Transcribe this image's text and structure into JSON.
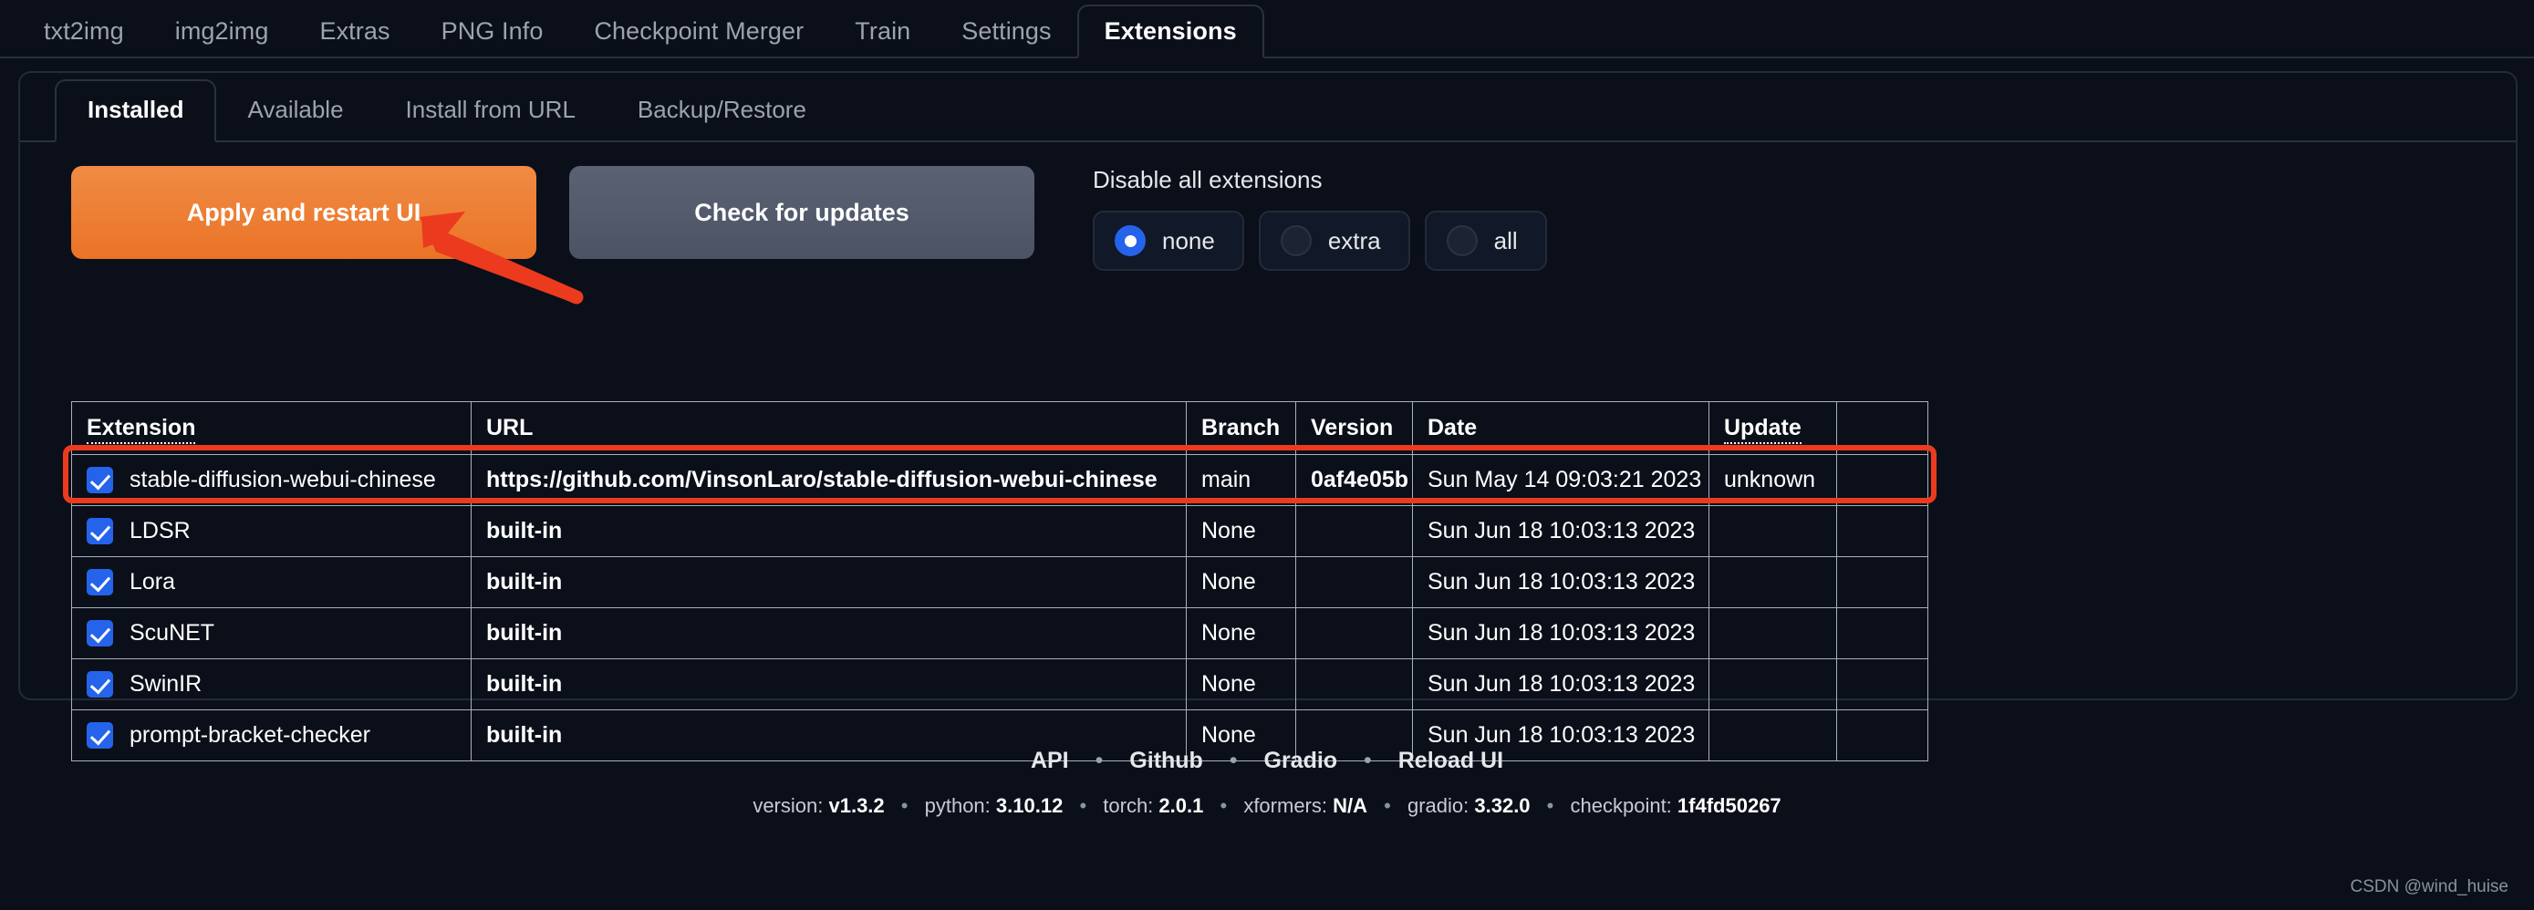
{
  "top_tabs": [
    {
      "label": "txt2img",
      "active": false
    },
    {
      "label": "img2img",
      "active": false
    },
    {
      "label": "Extras",
      "active": false
    },
    {
      "label": "PNG Info",
      "active": false
    },
    {
      "label": "Checkpoint Merger",
      "active": false
    },
    {
      "label": "Train",
      "active": false
    },
    {
      "label": "Settings",
      "active": false
    },
    {
      "label": "Extensions",
      "active": true
    }
  ],
  "sub_tabs": [
    {
      "label": "Installed",
      "active": true
    },
    {
      "label": "Available",
      "active": false
    },
    {
      "label": "Install from URL",
      "active": false
    },
    {
      "label": "Backup/Restore",
      "active": false
    }
  ],
  "controls": {
    "apply_label": "Apply and restart UI",
    "check_label": "Check for updates",
    "disable_label": "Disable all extensions",
    "radios": [
      {
        "label": "none",
        "selected": true
      },
      {
        "label": "extra",
        "selected": false
      },
      {
        "label": "all",
        "selected": false
      }
    ]
  },
  "table": {
    "headers": [
      "Extension",
      "URL",
      "Branch",
      "Version",
      "Date",
      "Update",
      ""
    ],
    "rows": [
      {
        "checked": true,
        "extension": "stable-diffusion-webui-chinese",
        "url": "https://github.com/VinsonLaro/stable-diffusion-webui-chinese",
        "branch": "main",
        "version": "0af4e05b",
        "date": "Sun May 14 09:03:21 2023",
        "update": "unknown",
        "action": "",
        "highlighted": true
      },
      {
        "checked": true,
        "extension": "LDSR",
        "url": "built-in",
        "branch": "None",
        "version": "",
        "date": "Sun Jun 18 10:03:13 2023",
        "update": "",
        "action": "",
        "highlighted": false
      },
      {
        "checked": true,
        "extension": "Lora",
        "url": "built-in",
        "branch": "None",
        "version": "",
        "date": "Sun Jun 18 10:03:13 2023",
        "update": "",
        "action": "",
        "highlighted": false
      },
      {
        "checked": true,
        "extension": "ScuNET",
        "url": "built-in",
        "branch": "None",
        "version": "",
        "date": "Sun Jun 18 10:03:13 2023",
        "update": "",
        "action": "",
        "highlighted": false
      },
      {
        "checked": true,
        "extension": "SwinIR",
        "url": "built-in",
        "branch": "None",
        "version": "",
        "date": "Sun Jun 18 10:03:13 2023",
        "update": "",
        "action": "",
        "highlighted": false
      },
      {
        "checked": true,
        "extension": "prompt-bracket-checker",
        "url": "built-in",
        "branch": "None",
        "version": "",
        "date": "Sun Jun 18 10:03:13 2023",
        "update": "",
        "action": "",
        "highlighted": false
      }
    ]
  },
  "footer": {
    "links": [
      "API",
      "Github",
      "Gradio",
      "Reload UI"
    ],
    "separator": "•",
    "versions": [
      {
        "key": "version:",
        "value": "v1.3.2"
      },
      {
        "key": "python:",
        "value": "3.10.12"
      },
      {
        "key": "torch:",
        "value": "2.0.1"
      },
      {
        "key": "xformers:",
        "value": "N/A"
      },
      {
        "key": "gradio:",
        "value": "3.32.0"
      },
      {
        "key": "checkpoint:",
        "value": "1f4fd50267"
      }
    ]
  },
  "watermark": "CSDN @wind_huise",
  "colors": {
    "accent_orange": "#ea7326",
    "annotation_red": "#ec3a1e",
    "radio_blue": "#2563eb",
    "background": "#0b0f19"
  }
}
